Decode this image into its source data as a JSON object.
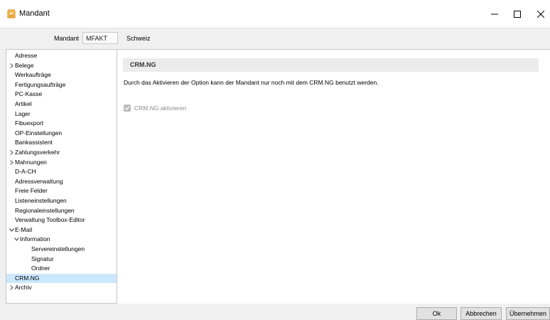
{
  "window": {
    "title": "Mandant",
    "minimize_glyph": "–",
    "maximize_glyph": "☐",
    "close_glyph": "X"
  },
  "mandant": {
    "label": "Mandant",
    "value": "MFAKT",
    "name": "Schweiz"
  },
  "tree": {
    "items": [
      {
        "label": "Adresse",
        "indent": 0,
        "expander": "none"
      },
      {
        "label": "Belege",
        "indent": 0,
        "expander": "collapsed"
      },
      {
        "label": "Werkaufträge",
        "indent": 0,
        "expander": "none"
      },
      {
        "label": "Fertigungsaufträge",
        "indent": 0,
        "expander": "none"
      },
      {
        "label": "PC-Kasse",
        "indent": 0,
        "expander": "none"
      },
      {
        "label": "Artikel",
        "indent": 0,
        "expander": "none"
      },
      {
        "label": "Lager",
        "indent": 0,
        "expander": "none"
      },
      {
        "label": "Fibuexport",
        "indent": 0,
        "expander": "none"
      },
      {
        "label": "OP-Einstellungen",
        "indent": 0,
        "expander": "none"
      },
      {
        "label": "Bankassistent",
        "indent": 0,
        "expander": "none"
      },
      {
        "label": "Zahlungsverkehr",
        "indent": 0,
        "expander": "collapsed"
      },
      {
        "label": "Mahnungen",
        "indent": 0,
        "expander": "collapsed"
      },
      {
        "label": "D-A-CH",
        "indent": 0,
        "expander": "none"
      },
      {
        "label": "Adressverwaltung",
        "indent": 0,
        "expander": "none"
      },
      {
        "label": "Freie Felder",
        "indent": 0,
        "expander": "none"
      },
      {
        "label": "Listeneinstellungen",
        "indent": 0,
        "expander": "none"
      },
      {
        "label": "Regionaleinstellungen",
        "indent": 0,
        "expander": "none"
      },
      {
        "label": "Verwaltung Toolbox-Editor",
        "indent": 0,
        "expander": "none"
      },
      {
        "label": "E-Mail",
        "indent": 0,
        "expander": "expanded"
      },
      {
        "label": "Information",
        "indent": 1,
        "expander": "expanded"
      },
      {
        "label": "Servereinstellungen",
        "indent": 2,
        "expander": "none"
      },
      {
        "label": "Signatur",
        "indent": 2,
        "expander": "none"
      },
      {
        "label": "Ordner",
        "indent": 2,
        "expander": "none"
      },
      {
        "label": "CRM.NG",
        "indent": 0,
        "expander": "none",
        "selected": true
      },
      {
        "label": "Archiv",
        "indent": 0,
        "expander": "collapsed"
      }
    ]
  },
  "content": {
    "section_title": "CRM.NG",
    "description": "Durch das Aktivieren der Option kann der Mandant nur noch mit dem CRM.NG benutzt werden.",
    "checkbox": {
      "label": "CRM.NG aktivieren",
      "checked": true,
      "disabled": true
    }
  },
  "buttons": {
    "ok": "Ok",
    "cancel": "Abbrechen",
    "apply": "Übernehmen"
  },
  "colors": {
    "selection": "#cce8ff",
    "section_header": "#ececec",
    "app_icon": "#e8a33d"
  },
  "icons": {
    "app": "app-logo-icon",
    "expand": "chevron-right-icon",
    "collapse": "chevron-down-icon"
  }
}
